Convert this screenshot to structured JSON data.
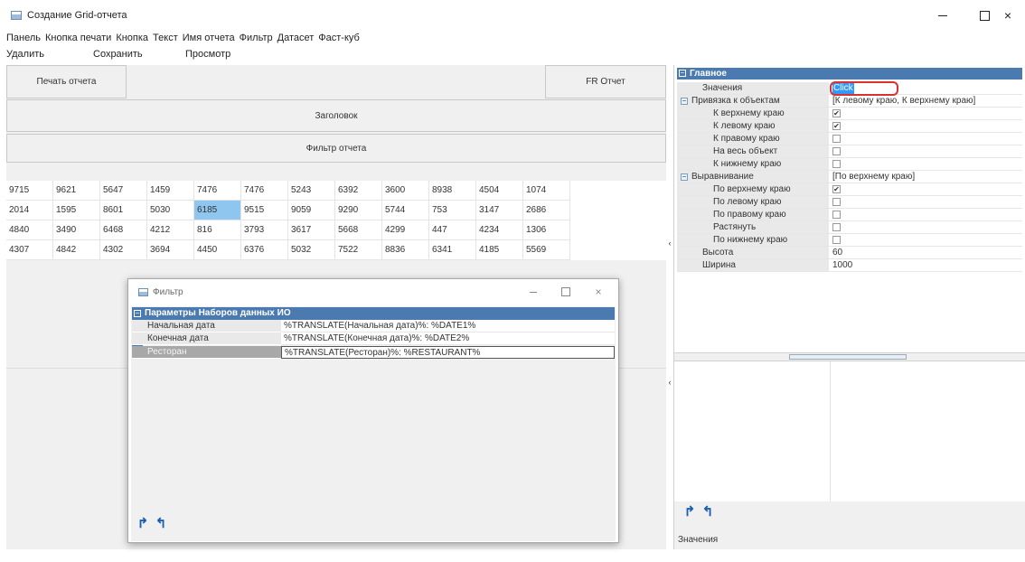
{
  "window": {
    "title": "Создание Grid-отчета"
  },
  "menu": [
    "Панель",
    "Кнопка печати",
    "Кнопка",
    "Текст",
    "Имя отчета",
    "Фильтр",
    "Датасет",
    "Фаст-куб"
  ],
  "actions": {
    "delete": "Удалить",
    "save": "Сохранить",
    "preview": "Просмотр"
  },
  "buttons": {
    "print": "Печать отчета",
    "fr": "FR Отчет",
    "header": "Заголовок",
    "filter": "Фильтр отчета"
  },
  "grid": {
    "rows": [
      [
        "9715",
        "9621",
        "5647",
        "1459",
        "7476",
        "7476",
        "5243",
        "6392",
        "3600",
        "8938",
        "4504",
        "1074"
      ],
      [
        "2014",
        "1595",
        "8601",
        "5030",
        "6185",
        "9515",
        "9059",
        "9290",
        "5744",
        "753",
        "3147",
        "2686"
      ],
      [
        "4840",
        "3490",
        "6468",
        "4212",
        "816",
        "3793",
        "3617",
        "5668",
        "4299",
        "447",
        "4234",
        "1306"
      ],
      [
        "4307",
        "4842",
        "4302",
        "3694",
        "4450",
        "6376",
        "5032",
        "7522",
        "8836",
        "6341",
        "4185",
        "5569"
      ]
    ],
    "selected": {
      "row": 1,
      "col": 4
    }
  },
  "properties": {
    "section": "Главное",
    "rows": [
      {
        "name": "Значения",
        "value": "Click",
        "type": "input"
      },
      {
        "name": "Привязка к объектам",
        "value": "[К левому краю, К верхнему краю]",
        "type": "group"
      },
      {
        "name": "К верхнему краю",
        "value": "✔",
        "type": "check"
      },
      {
        "name": "К левому краю",
        "value": "✔",
        "type": "check"
      },
      {
        "name": "К правому краю",
        "value": "",
        "type": "check"
      },
      {
        "name": "На весь объект",
        "value": "",
        "type": "check"
      },
      {
        "name": "К нижнему краю",
        "value": "",
        "type": "check"
      },
      {
        "name": "Выравнивание",
        "value": "[По верхнему краю]",
        "type": "group"
      },
      {
        "name": "По верхнему краю",
        "value": "✔",
        "type": "check"
      },
      {
        "name": "По левому краю",
        "value": "",
        "type": "check"
      },
      {
        "name": "По правому краю",
        "value": "",
        "type": "check"
      },
      {
        "name": "Растянуть",
        "value": "",
        "type": "check"
      },
      {
        "name": "По нижнему краю",
        "value": "",
        "type": "check"
      },
      {
        "name": "Высота",
        "value": "60",
        "type": "text"
      },
      {
        "name": "Ширина",
        "value": "1000",
        "type": "text"
      }
    ],
    "description_label": "Значения"
  },
  "filter_dialog": {
    "title": "Фильтр",
    "section": "Параметры Наборов данных ИО",
    "rows": [
      {
        "name": "Начальная дата",
        "value": "%TRANSLATE(Начальная дата)%: %DATE1%"
      },
      {
        "name": "Конечная дата",
        "value": "%TRANSLATE(Конечная дата)%: %DATE2%"
      },
      {
        "name": "Ресторан",
        "value": "%TRANSLATE(Ресторан)%: %RESTAURANT%"
      }
    ]
  },
  "icons": {
    "sort_asc": "sort-up-icon",
    "sort_desc": "sort-down-icon",
    "close": "×"
  }
}
